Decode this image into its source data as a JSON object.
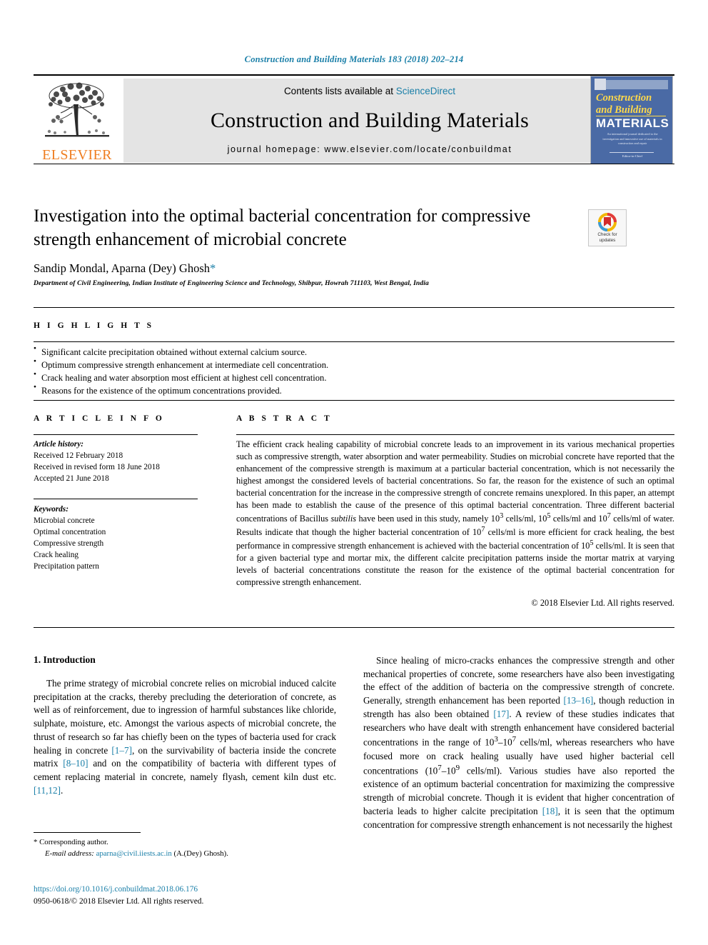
{
  "running_head": "Construction and Building Materials 183 (2018) 202–214",
  "masthead": {
    "publisher_logo_name": "elsevier-tree-logo",
    "publisher_wordmark": "ELSEVIER",
    "contents_prefix": "Contents lists available at ",
    "contents_link": "ScienceDirect",
    "journal_title": "Construction and Building Materials",
    "homepage": "journal homepage: www.elsevier.com/locate/conbuildmat",
    "cover": {
      "line1": "Construction",
      "line2": "and Building",
      "line3": "MATERIALS",
      "blurb": "An international journal dedicated to the investigation and innovative use of materials in construction and repair",
      "footer": "Editor-in-Chief"
    }
  },
  "article": {
    "title": "Investigation into the optimal bacterial concentration for compressive strength enhancement of microbial concrete",
    "authors": "Sandip Mondal, Aparna (Dey) Ghosh",
    "corresponding_marker": "*",
    "affiliation": "Department of Civil Engineering, Indian Institute of Engineering Science and Technology, Shibpur, Howrah 711103, West Bengal, India",
    "crossmark": {
      "line1": "Check for",
      "line2": "updates"
    }
  },
  "highlights": {
    "heading": "H I G H L I G H T S",
    "items": [
      "Significant calcite precipitation obtained without external calcium source.",
      "Optimum compressive strength enhancement at intermediate cell concentration.",
      "Crack healing and water absorption most efficient at highest cell concentration.",
      "Reasons for the existence of the optimum concentrations provided."
    ]
  },
  "article_info": {
    "heading": "A R T I C L E   I N F O",
    "history_label": "Article history:",
    "history": [
      "Received 12 February 2018",
      "Received in revised form 18 June 2018",
      "Accepted 21 June 2018"
    ],
    "keywords_label": "Keywords:",
    "keywords": [
      "Microbial concrete",
      "Optimal concentration",
      "Compressive strength",
      "Crack healing",
      "Precipitation pattern"
    ]
  },
  "abstract": {
    "heading": "A B S T R A C T",
    "text_part1": "The efficient crack healing capability of microbial concrete leads to an improvement in its various mechanical properties such as compressive strength, water absorption and water permeability. Studies on microbial concrete have reported that the enhancement of the compressive strength is maximum at a particular bacterial concentration, which is not necessarily the highest amongst the considered levels of bacterial concentrations. So far, the reason for the existence of such an optimal bacterial concentration for the increase in the compressive strength of concrete remains unexplored. In this paper, an attempt has been made to establish the cause of the presence of this optimal bacterial concentration. Three different bacterial concentrations of Bacillus ",
    "species_italic": "subtilis",
    "text_part2": " have been used in this study, namely 10",
    "exp1": "3",
    "text_part3": " cells/ml, 10",
    "exp2": "5",
    "text_part4": " cells/ml and 10",
    "exp3": "7",
    "text_part5": " cells/ml of water. Results indicate that though the higher bacterial concentration of 10",
    "exp4": "7",
    "text_part6": " cells/ml is more efficient for crack healing, the best performance in compressive strength enhancement is achieved with the bacterial concentration of 10",
    "exp5": "5",
    "text_part7": " cells/ml. It is seen that for a given bacterial type and mortar mix, the different calcite precipitation patterns inside the mortar matrix at varying levels of bacterial concentrations constitute the reason for the existence of the optimal bacterial concentration for compressive strength enhancement.",
    "copyright": "© 2018 Elsevier Ltd. All rights reserved."
  },
  "body": {
    "section_title": "1. Introduction",
    "left_par_a": "The prime strategy of microbial concrete relies on microbial induced calcite precipitation at the cracks, thereby precluding the deterioration of concrete, as well as of reinforcement, due to ingression of harmful substances like chloride, sulphate, moisture, etc. Amongst the various aspects of microbial concrete, the thrust of research so far has chiefly been on the types of bacteria used for crack healing in concrete ",
    "left_ref1": "[1–7]",
    "left_par_b": ", on the survivability of bacteria inside the concrete matrix ",
    "left_ref2": "[8–10]",
    "left_par_c": " and on the compatibility of bacteria with different types of cement replacing material in concrete, namely flyash, cement kiln dust etc. ",
    "left_ref3": "[11,12]",
    "left_par_d": ".",
    "right_par_a": "Since healing of micro-cracks enhances the compressive strength and other mechanical properties of concrete, some researchers have also been investigating the effect of the addition of bacteria on the compressive strength of concrete. Generally, strength enhancement has been reported ",
    "right_ref1": "[13–16]",
    "right_par_b": ", though reduction in strength has also been obtained ",
    "right_ref2": "[17]",
    "right_par_c": ". A review of these studies indicates that researchers who have dealt with strength enhancement have considered bacterial concentrations in the range of 10",
    "right_exp1": "3",
    "right_par_d": "–10",
    "right_exp2": "7",
    "right_par_e": " cells/ml, whereas researchers who have focused more on crack healing usually have used higher bacterial cell concentrations (10",
    "right_exp3": "7",
    "right_par_f": "–10",
    "right_exp4": "9",
    "right_par_g": " cells/ml). Various studies have also reported the existence of an optimum bacterial concentration for maximizing the compressive strength of microbial concrete. Though it is evident that higher concentration of bacteria leads to higher calcite precipitation ",
    "right_ref3": "[18]",
    "right_par_h": ", it is seen that the optimum concentration for compressive strength enhancement is not necessarily the highest"
  },
  "footer": {
    "corresponding_marker": "*",
    "corresponding_text": "Corresponding author.",
    "email_label": "E-mail address:",
    "email": "aparna@civil.iiests.ac.in",
    "email_owner": "(A.(Dey) Ghosh).",
    "doi": "https://doi.org/10.1016/j.conbuildmat.2018.06.176",
    "issn_line": "0950-0618/© 2018 Elsevier Ltd. All rights reserved."
  },
  "colors": {
    "link": "#1a7fa8",
    "elsevier_orange": "#ef7d20",
    "cover_blue": "#4a6aa5",
    "cover_yellow": "#ffd94a"
  }
}
